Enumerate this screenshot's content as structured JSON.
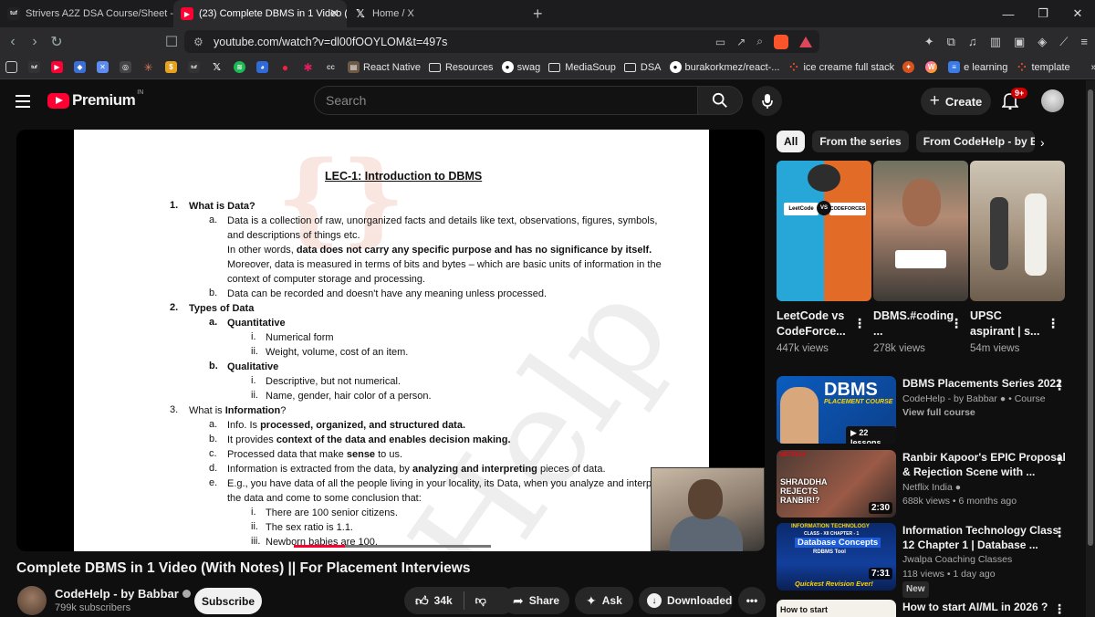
{
  "browser": {
    "tabs": [
      {
        "label": "Strivers A2Z DSA Course/Sheet - Cra",
        "active": false
      },
      {
        "label": "(23) Complete DBMS in 1 Video (",
        "active": true
      },
      {
        "label": "Home / X",
        "active": false
      }
    ],
    "url": "youtube.com/watch?v=dl00fOOYLOM&t=497s",
    "bookmarks": [
      "React Native",
      "Resources",
      "swag",
      "MediaSoup",
      "DSA",
      "burakorkmez/react-...",
      "ice creame full stack",
      "e learning",
      "template"
    ]
  },
  "youtube": {
    "logo_text": "Premium",
    "region": "IN",
    "search_placeholder": "Search",
    "create_label": "Create",
    "notif_count": "9+"
  },
  "video": {
    "title": "Complete DBMS in 1 Video (With Notes) || For Placement Interviews",
    "channel": "CodeHelp - by Babbar",
    "subscribers": "799k subscribers",
    "subscribe_label": "Subscribe",
    "likes": "34k",
    "share_label": "Share",
    "ask_label": "Ask",
    "downloaded_label": "Downloaded",
    "progress_fraction": 0.26
  },
  "doc": {
    "heading": "LEC-1: Introduction to DBMS",
    "lines": [
      {
        "n": "1.",
        "text": "What is Data?",
        "bold": true
      },
      {
        "n": "a.",
        "text": "Data is a collection of raw, unorganized facts and details like text, observations, figures, symbols,"
      },
      {
        "text": "and descriptions of things etc."
      },
      {
        "text_pre": "In other words, ",
        "text_bold": "data does not carry any specific purpose and has no significance by itself."
      },
      {
        "text": "Moreover, data is measured in terms of bits and bytes – which are basic units of information in the"
      },
      {
        "text": "context of computer storage and processing."
      },
      {
        "n": "b.",
        "text": "Data can be recorded and doesn't have any meaning unless processed."
      },
      {
        "n": "2.",
        "text": "Types of Data",
        "bold": true
      },
      {
        "n": "a.",
        "text": "Quantitative",
        "bold": true
      },
      {
        "n": "i.",
        "text": "Numerical form"
      },
      {
        "n": "ii.",
        "text": "Weight, volume, cost of an item."
      },
      {
        "n": "b.",
        "text": "Qualitative",
        "bold": true
      },
      {
        "n": "i.",
        "text": "Descriptive, but not numerical."
      },
      {
        "n": "ii.",
        "text": "Name, gender, hair color of a person."
      },
      {
        "n": "3.",
        "text_pre": "What is ",
        "text_bold": "Information",
        "text_post": "?"
      },
      {
        "n": "a.",
        "text_pre": "Info. Is ",
        "text_bold": "processed, organized, and structured data."
      },
      {
        "n": "b.",
        "text_pre": "It provides ",
        "text_bold": "context of the data and enables decision making."
      },
      {
        "n": "c.",
        "text_pre": "Processed data that make ",
        "text_bold": "sense",
        "text_post": " to us."
      },
      {
        "n": "d.",
        "text_pre": "Information is extracted from the data, by ",
        "text_bold": "analyzing and interpreting",
        "text_post": " pieces of data."
      },
      {
        "n": "e.",
        "text": "E.g., you have data of all the people living in your locality, its Data, when you analyze and interpret"
      },
      {
        "text": "the data and come to some conclusion that:"
      },
      {
        "n": "i.",
        "text": "There are 100 senior citizens."
      },
      {
        "n": "ii.",
        "text": "The sex ratio is 1.1."
      },
      {
        "n": "iii.",
        "text": "Newborn babies are 100."
      }
    ]
  },
  "sidebar": {
    "chips": [
      "All",
      "From the series",
      "From CodeHelp - by Babbar"
    ],
    "shorts": [
      {
        "title": "LeetCode vs CodeForce...",
        "views": "447k views",
        "left_label": "LeetCode",
        "right_label": "CODEFORCES"
      },
      {
        "title": "DBMS.#coding ...",
        "views": "278k views"
      },
      {
        "title": "UPSC aspirant | s...",
        "views": "54m views"
      }
    ],
    "videos": [
      {
        "title": "DBMS Placements Series 2022",
        "channel": "CodeHelp - by Babbar",
        "extra": "Course",
        "meta2": "View full course",
        "thumb_big": "DBMS",
        "thumb_sub": "PLACEMENT COURSE",
        "thumb_badge": "22 lessons"
      },
      {
        "title": "Ranbir Kapoor's EPIC Proposal & Rejection Scene with ...",
        "channel": "Netflix India",
        "meta2": "688k views • 6 months ago",
        "duration": "2:30",
        "thumb_text": "SHRADDHA REJECTS RANBIR!?",
        "thumb_brand": "NETFLIX"
      },
      {
        "title": "Information Technology Class 12 Chapter 1 | Database ...",
        "channel": "Jwalpa Coaching Classes",
        "meta2": "118 views • 1 day ago",
        "badge": "New",
        "duration": "7:31",
        "thumb_top": "INFORMATION TECHNOLOGY",
        "thumb_class": "CLASS - XII  CHAPTER - 1",
        "thumb_main": "Database Concepts",
        "thumb_tool": "RDBMS Tool",
        "thumb_footer": "Quickest Revision Ever!"
      },
      {
        "title": "How to start AI/ML in 2026 ?",
        "thumb_text": "How to start"
      }
    ]
  }
}
